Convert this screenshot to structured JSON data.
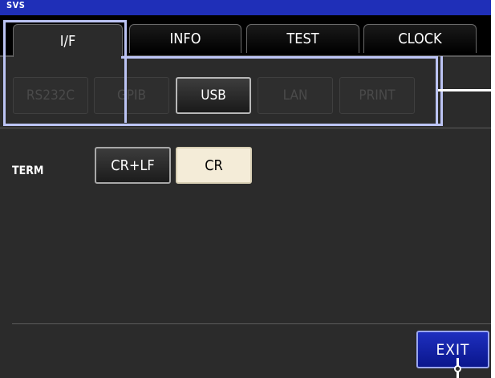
{
  "header": {
    "title": "SVS"
  },
  "tabs": [
    {
      "label": "I/F",
      "active": true
    },
    {
      "label": "INFO",
      "active": false
    },
    {
      "label": "TEST",
      "active": false
    },
    {
      "label": "CLOCK",
      "active": false
    }
  ],
  "interfaces": [
    {
      "label": "RS232C",
      "state": "disabled"
    },
    {
      "label": "GPIB",
      "state": "disabled"
    },
    {
      "label": "USB",
      "state": "selected"
    },
    {
      "label": "LAN",
      "state": "disabled"
    },
    {
      "label": "PRINT",
      "state": "disabled"
    }
  ],
  "term": {
    "label": "TERM",
    "options": [
      {
        "label": "CR+LF",
        "selected": false
      },
      {
        "label": "CR",
        "selected": true
      }
    ]
  },
  "footer": {
    "exit_label": "EXIT"
  },
  "colors": {
    "accent": "#1f2fb8",
    "highlight": "#bcc4f4",
    "selected_option": "#f4ecd8"
  }
}
